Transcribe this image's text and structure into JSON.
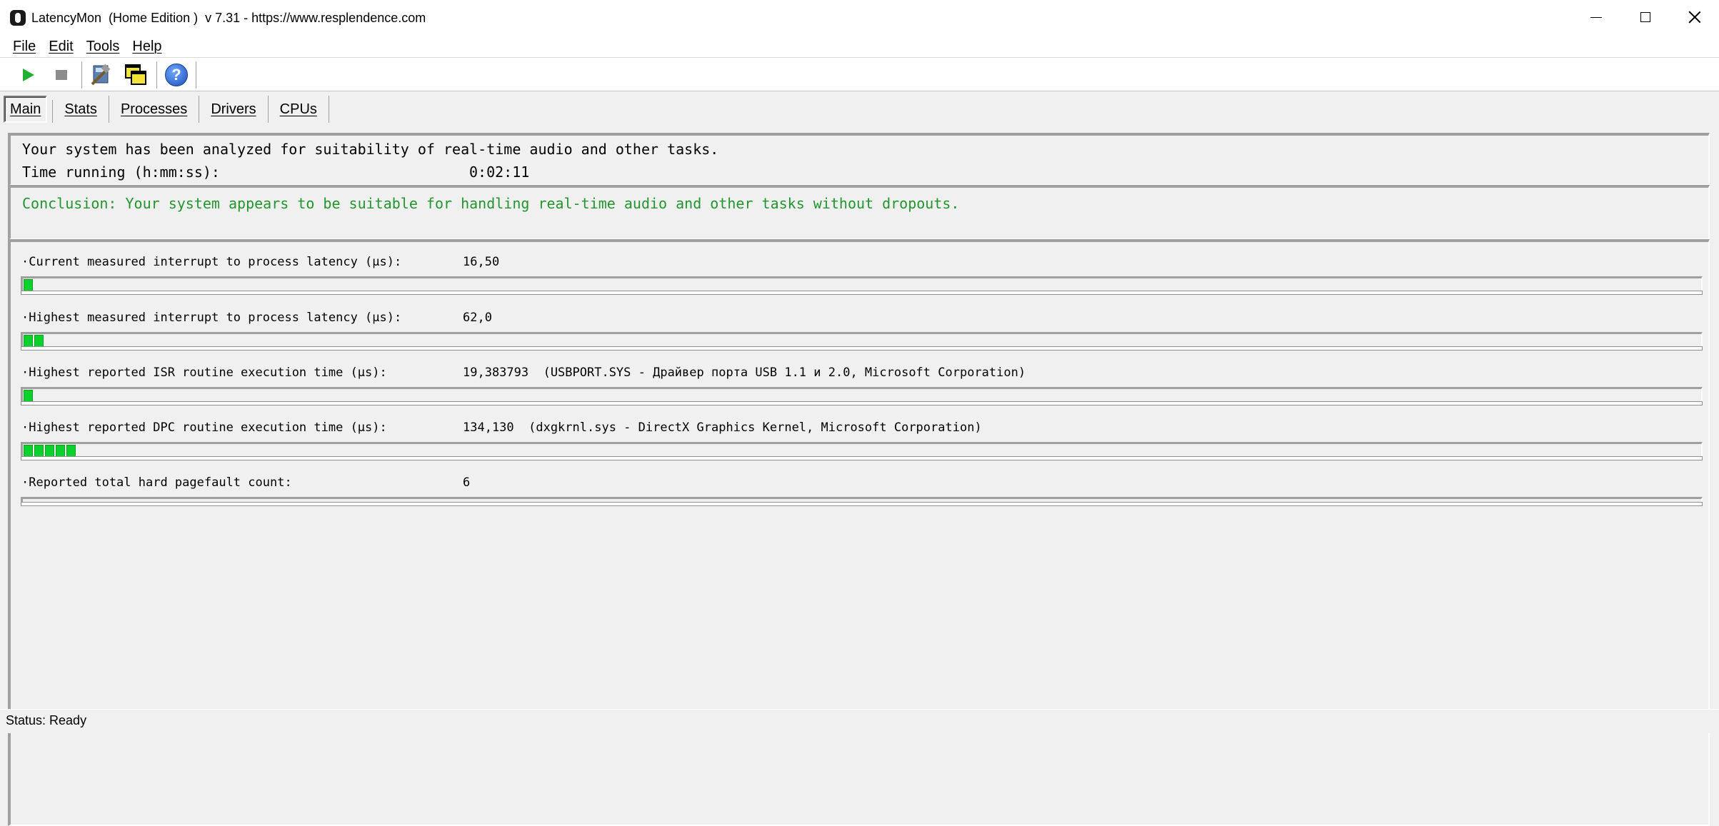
{
  "window": {
    "title": "LatencyMon  (Home Edition )  v 7.31 - https://www.resplendence.com"
  },
  "menu": {
    "items": [
      "File",
      "Edit",
      "Tools",
      "Help"
    ]
  },
  "toolbar": {
    "icons": [
      "play-icon",
      "stop-icon",
      "tools-icon",
      "windows-icon",
      "help-icon"
    ],
    "help_glyph": "?"
  },
  "tabs": [
    "Main",
    "Stats",
    "Processes",
    "Drivers",
    "CPUs"
  ],
  "summary": {
    "line1": "Your system has been analyzed for suitability of real-time audio and other tasks.",
    "time_label": "Time running (h:mm:ss):",
    "time_value": "0:02:11"
  },
  "conclusion": {
    "text": "Conclusion: Your system appears to be suitable for handling real-time audio and other tasks without dropouts.",
    "color": "#22952e"
  },
  "metrics": [
    {
      "label": "·Current measured interrupt to process latency (µs):",
      "value": "16,50",
      "level_segments": 1
    },
    {
      "label": "·Highest measured interrupt to process latency (µs):",
      "value": "62,0",
      "level_segments": 2
    },
    {
      "label": "·Highest reported ISR routine execution time (µs):",
      "value": "19,383793  (USBPORT.SYS - Драйвер порта USB 1.1 и 2.0, Microsoft Corporation)",
      "level_segments": 1
    },
    {
      "label": "·Highest reported DPC routine execution time (µs):",
      "value": "134,130  (dxgkrnl.sys - DirectX Graphics Kernel, Microsoft Corporation)",
      "level_segments": 5
    },
    {
      "label": "·Reported total hard pagefault count:",
      "value": "6",
      "level_segments": 0
    }
  ],
  "colors": {
    "bar_fill": "#0bd12c",
    "play": "#22b032"
  },
  "status": {
    "text": "Status: Ready"
  }
}
